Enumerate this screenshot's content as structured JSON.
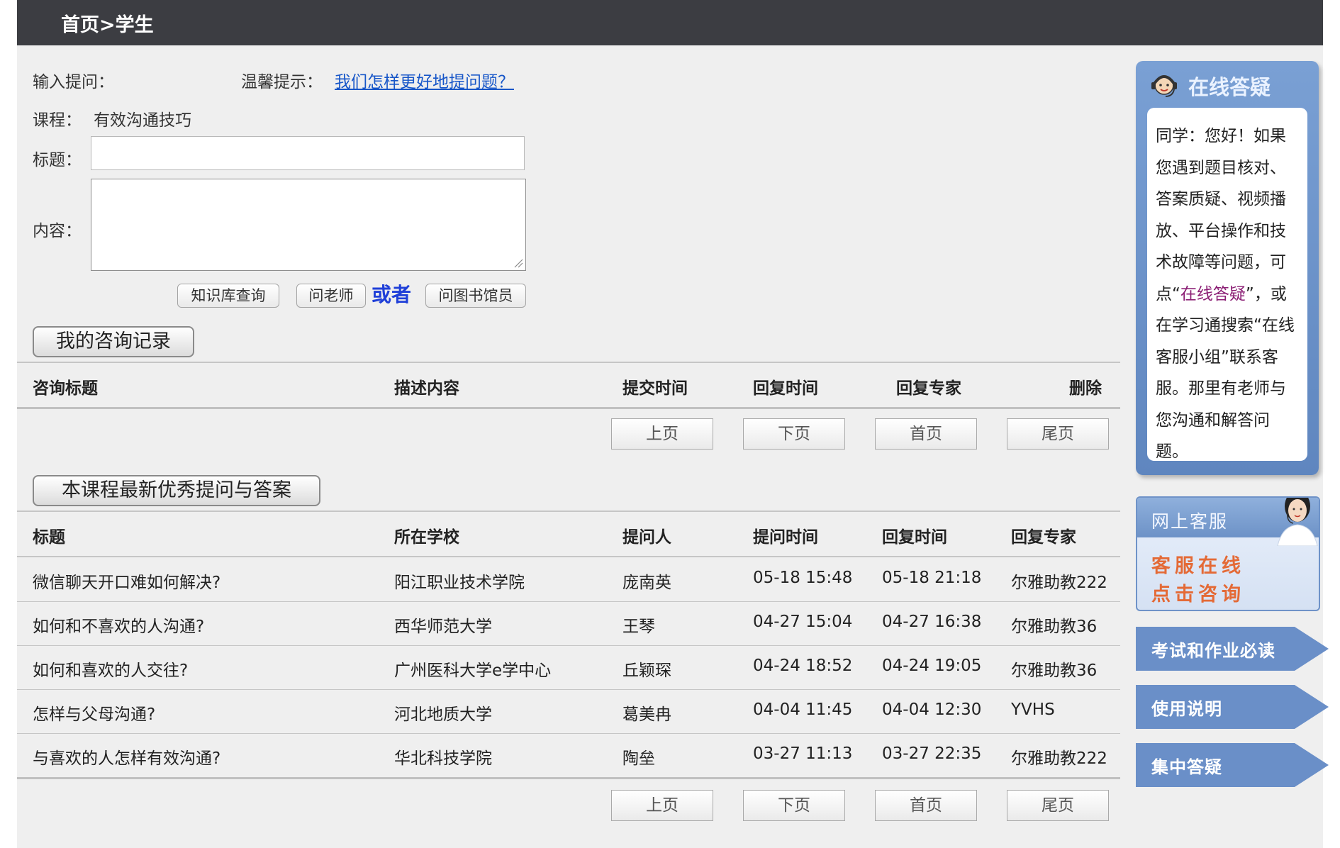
{
  "header": {
    "breadcrumb": "首页>学生"
  },
  "form": {
    "ask_label": "输入提问：",
    "tip_label": "温馨提示：",
    "tip_link": "我们怎样更好地提问题？",
    "course_label": "课程：",
    "course_name": "有效沟通技巧",
    "title_label": "标题：",
    "title_value": "",
    "content_label": "内容：",
    "content_value": "",
    "buttons": {
      "kb_search": "知识库查询",
      "ask_teacher": "问老师",
      "or": "或者",
      "ask_librarian": "问图书馆员"
    }
  },
  "my_records": {
    "button": "我的咨询记录",
    "headers": [
      "咨询标题",
      "描述内容",
      "提交时间",
      "回复时间",
      "回复专家",
      "删除"
    ],
    "rows": []
  },
  "pager": {
    "prev": "上页",
    "next": "下页",
    "first": "首页",
    "last": "尾页"
  },
  "best_qa": {
    "button": "本课程最新优秀提问与答案",
    "headers": [
      "标题",
      "所在学校",
      "提问人",
      "提问时间",
      "回复时间",
      "回复专家"
    ],
    "rows": [
      [
        "微信聊天开口难如何解决?",
        "阳江职业技术学院",
        "庞南英",
        "05-18 15:48",
        "05-18 21:18",
        "尔雅助教222"
      ],
      [
        "如何和不喜欢的人沟通?",
        "西华师范大学",
        "王琴",
        "04-27 15:04",
        "04-27 16:38",
        "尔雅助教36"
      ],
      [
        "如何和喜欢的人交往?",
        "广州医科大学e学中心",
        "丘颖琛",
        "04-24 18:52",
        "04-24 19:05",
        "尔雅助教36"
      ],
      [
        "怎样与父母沟通?",
        "河北地质大学",
        "葛美冉",
        "04-04 11:45",
        "04-04 12:30",
        "YVHS"
      ],
      [
        "与喜欢的人怎样有效沟通?",
        "华北科技学院",
        "陶垒",
        "03-27 11:13",
        "03-27 22:35",
        "尔雅助教222"
      ]
    ]
  },
  "sidebar": {
    "qa_title": "在线答疑",
    "qa_text_parts": [
      "同学：您好！如果您遇到题目核对、答案质疑、视频播放、平台操作和技术故障等问题，可点“",
      "在线答疑",
      "”，或在学习通搜索“在线客服小组”联系客服。那里有老师与您沟通和解答问题。"
    ],
    "service_title": "网上客服",
    "service_line1": "客服在线",
    "service_line2": "点击咨询",
    "links": [
      "考试和作业必读",
      "使用说明",
      "集中答疑"
    ]
  },
  "colors": {
    "header_bg": "#3c3d42",
    "sidebar_blue": "#6a8fc8",
    "link_blue": "#1756c8",
    "highlight": "#8b1e74",
    "accent_orange": "#e46a36"
  }
}
